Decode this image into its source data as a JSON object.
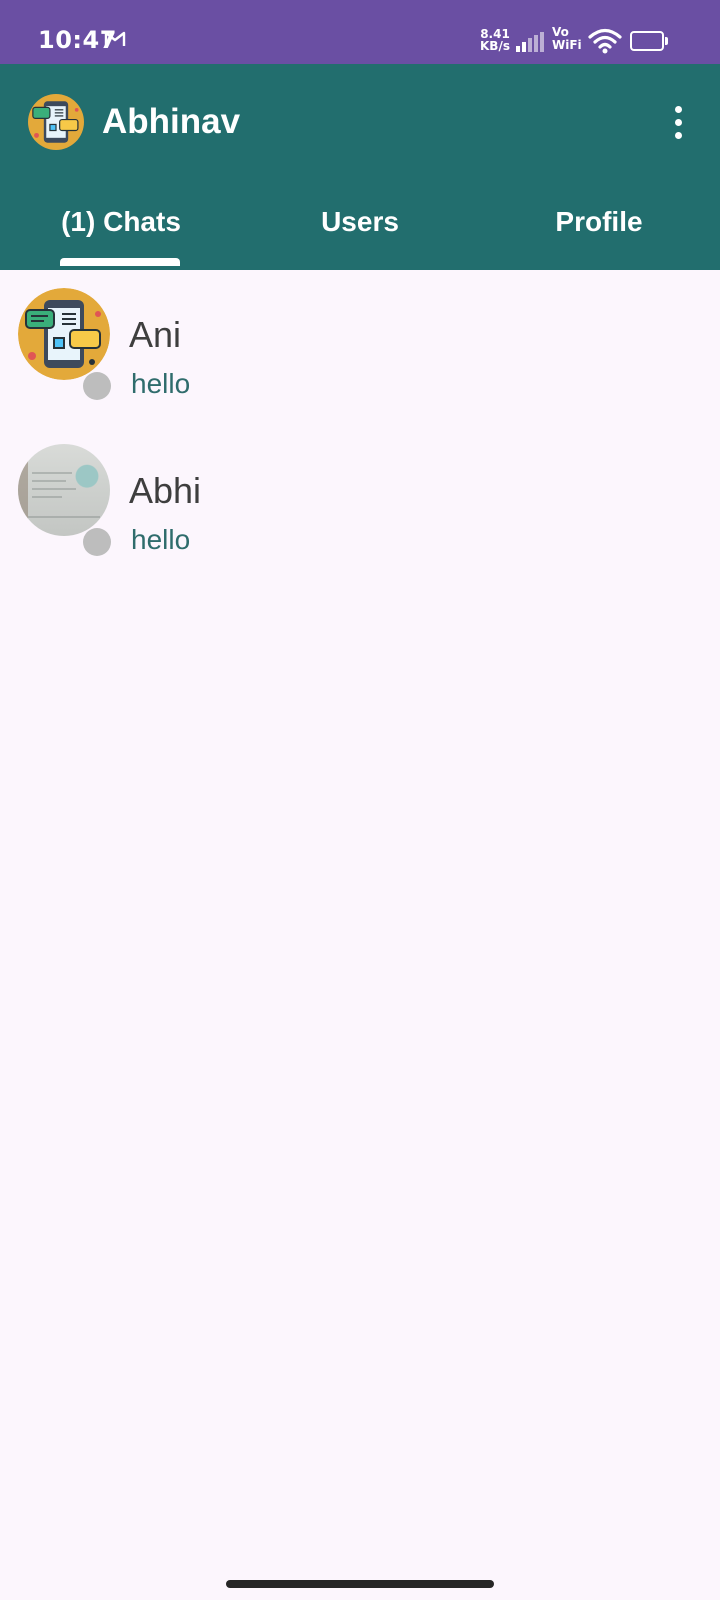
{
  "status_bar": {
    "time": "10:47",
    "net_speed_value": "8.41",
    "net_speed_unit": "KB/s",
    "vo": "Vo",
    "wifi_label": "WiFi",
    "battery": "91",
    "battery_level": 0.91,
    "background_color": "#6a4fa3"
  },
  "app_bar": {
    "title": "Abhinav",
    "background_color": "#226e6e",
    "menu_icon": "more-vert-icon",
    "logo_icon": "chat-phone-icon"
  },
  "tabs": [
    {
      "label": "(1) Chats",
      "selected": true
    },
    {
      "label": "Users",
      "selected": false
    },
    {
      "label": "Profile",
      "selected": false
    }
  ],
  "chats": [
    {
      "name": "Ani",
      "last_message": "hello",
      "avatar": "chat-phone-icon",
      "online": false
    },
    {
      "name": "Abhi",
      "last_message": "hello",
      "avatar": "user-photo",
      "online": false
    }
  ],
  "colors": {
    "accent": "#226e6e",
    "message_text": "#2f6c6c",
    "background": "#fcf6fd",
    "offline_dot": "#bdbdbd"
  }
}
